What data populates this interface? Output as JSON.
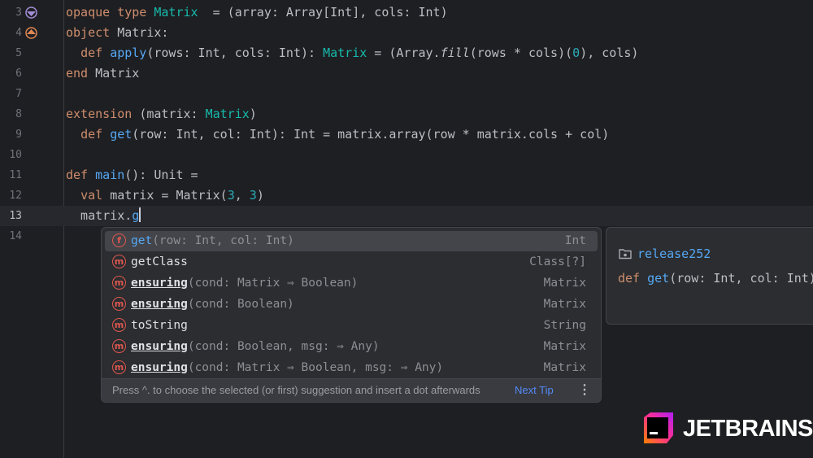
{
  "editor": {
    "lines": [
      {
        "number": "3",
        "tokens": [
          [
            "kw",
            "opaque type "
          ],
          [
            "ty",
            "Matrix"
          ],
          [
            "",
            "  = (array: Array[Int], cols: Int)"
          ]
        ]
      },
      {
        "number": "4",
        "tokens": [
          [
            "kw",
            "object "
          ],
          [
            "",
            "Matrix:"
          ]
        ]
      },
      {
        "number": "5",
        "tokens": [
          [
            "",
            "  "
          ],
          [
            "kw",
            "def "
          ],
          [
            "fn",
            "apply"
          ],
          [
            "",
            "(rows: Int, cols: Int): "
          ],
          [
            "ty",
            "Matrix"
          ],
          [
            "",
            " = (Array."
          ],
          [
            "it",
            "fill"
          ],
          [
            "",
            "(rows * cols)("
          ],
          [
            "nm",
            "0"
          ],
          [
            "",
            "), cols)"
          ]
        ]
      },
      {
        "number": "6",
        "tokens": [
          [
            "kw",
            "end "
          ],
          [
            "",
            "Matrix"
          ]
        ]
      },
      {
        "number": "7",
        "tokens": []
      },
      {
        "number": "8",
        "tokens": [
          [
            "kw",
            "extension "
          ],
          [
            "",
            "(matrix: "
          ],
          [
            "ty",
            "Matrix"
          ],
          [
            "",
            ")"
          ]
        ]
      },
      {
        "number": "9",
        "tokens": [
          [
            "",
            "  "
          ],
          [
            "kw",
            "def "
          ],
          [
            "fn",
            "get"
          ],
          [
            "",
            "(row: Int, col: Int): Int = matrix.array(row * matrix.cols + col)"
          ]
        ]
      },
      {
        "number": "10",
        "tokens": []
      },
      {
        "number": "11",
        "tokens": [
          [
            "kw",
            "def "
          ],
          [
            "fn",
            "main"
          ],
          [
            "",
            "(): Unit ="
          ]
        ]
      },
      {
        "number": "12",
        "tokens": [
          [
            "",
            "  "
          ],
          [
            "kw",
            "val "
          ],
          [
            "",
            "matrix = Matrix("
          ],
          [
            "nm",
            "3"
          ],
          [
            "",
            ", "
          ],
          [
            "nm",
            "3"
          ],
          [
            "",
            ")"
          ]
        ]
      },
      {
        "number": "13",
        "tokens": [
          [
            "",
            "  matrix."
          ],
          [
            "fn",
            "g"
          ]
        ]
      },
      {
        "number": "14",
        "tokens": []
      }
    ]
  },
  "completion": {
    "items": [
      {
        "badge": "f",
        "name": "get",
        "params": "(row: Int, col: Int)",
        "type": "Int"
      },
      {
        "badge": "m",
        "name": "getClass",
        "params": "",
        "type": "Class[?]"
      },
      {
        "badge": "m",
        "name": "ensuring",
        "params": "(cond: Matrix ⇒ Boolean)",
        "type": "Matrix"
      },
      {
        "badge": "m",
        "name": "ensuring",
        "params": "(cond: Boolean)",
        "type": "Matrix"
      },
      {
        "badge": "m",
        "name": "toString",
        "params": "",
        "type": "String"
      },
      {
        "badge": "m",
        "name": "ensuring",
        "params": "(cond: Boolean, msg: ⇒ Any)",
        "type": "Matrix"
      },
      {
        "badge": "m",
        "name": "ensuring",
        "params": "(cond: Matrix ⇒ Boolean, msg: ⇒ Any)",
        "type": "Matrix"
      }
    ],
    "footer_text": "Press ^. to choose the selected (or first) suggestion and insert a dot afterwards",
    "next_tip": "Next Tip"
  },
  "documentation": {
    "module": "release252",
    "signature": [
      [
        "kw",
        "def "
      ],
      [
        "fn",
        "get"
      ],
      [
        "",
        "(row: Int, col: Int): Int"
      ]
    ]
  },
  "logo": {
    "text": "JETBRAINS"
  }
}
